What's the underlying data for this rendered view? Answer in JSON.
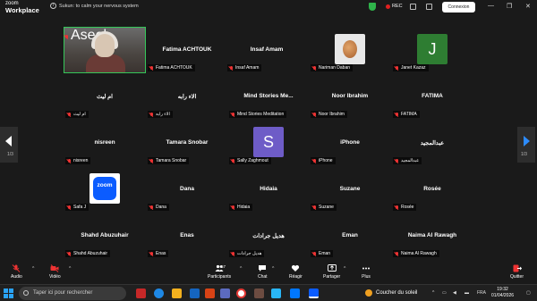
{
  "titlebar": {
    "brand_line1": "zoom",
    "brand_line2": "Workplace",
    "info_text": "Sukun: to calm your nervous system",
    "rec_label": "REC",
    "connect_label": "Connexion",
    "minimize": "—",
    "maximize": "❐",
    "close": "✕"
  },
  "grid": {
    "page_left": "1/3",
    "page_right": "1/3",
    "tiles": [
      {
        "name": "",
        "label": "Aseel"
      },
      {
        "name": "Fatima ACHTOUK",
        "label": "Fatima ACHTOUK"
      },
      {
        "name": "Insaf Amam",
        "label": "Insaf Amam"
      },
      {
        "name": "",
        "label": "Nariman Daban"
      },
      {
        "name": "",
        "label": "Janet Kazaz",
        "avatar_letter": "J"
      },
      {
        "name": "ام ليث",
        "label": "ام ليث"
      },
      {
        "name": "الاء رابه",
        "label": "الاء رابه"
      },
      {
        "name": "Mind Stories Me...",
        "label": "Mind Stories Meditation"
      },
      {
        "name": "Noor Ibrahim",
        "label": "Noor Ibrahim"
      },
      {
        "name": "FATIMA",
        "label": "FATIMA"
      },
      {
        "name": "nisreen",
        "label": "nisreen"
      },
      {
        "name": "Tamara Snobar",
        "label": "Tamara Snobar"
      },
      {
        "name": "",
        "label": "Sally Zaghmout",
        "avatar_letter": "S"
      },
      {
        "name": "iPhone",
        "label": "iPhone"
      },
      {
        "name": "عبدالمجيد",
        "label": "عبدالمجيد"
      },
      {
        "name": "",
        "label": "Safa J",
        "avatar_text": "zoom"
      },
      {
        "name": "Dana",
        "label": "Dana"
      },
      {
        "name": "Hidaia",
        "label": "Hidaia"
      },
      {
        "name": "Suzane",
        "label": "Suzane"
      },
      {
        "name": "Rosée",
        "label": "Rosée"
      },
      {
        "name": "Shahd Abuzuhair",
        "label": "Shahd Abuzuhair"
      },
      {
        "name": "Enas",
        "label": "Enas"
      },
      {
        "name": "هديل جرادات",
        "label": "هديل جرادات"
      },
      {
        "name": "Eman",
        "label": "Eman"
      },
      {
        "name": "Naima Al Rawagh",
        "label": "Naima Al Rawagh"
      }
    ]
  },
  "toolbar": {
    "audio": "Audio",
    "video": "Vidéo",
    "participants": "Participants",
    "participants_count": "57",
    "chat": "Chat",
    "react": "Réagir",
    "share": "Partager",
    "more": "Plus",
    "quit": "Quitter"
  },
  "taskbar": {
    "search_placeholder": "Taper ici pour rechercher",
    "weather": "Coucher du soleil",
    "lang": "FRA",
    "time": "19:32",
    "date": "01/04/2026"
  },
  "colors": {
    "accent_green": "#35c759",
    "zoom_blue": "#0b5cff",
    "muted_red": "#e33333",
    "avatar_green": "#2e7d32",
    "avatar_purple": "#6e5cc7"
  }
}
